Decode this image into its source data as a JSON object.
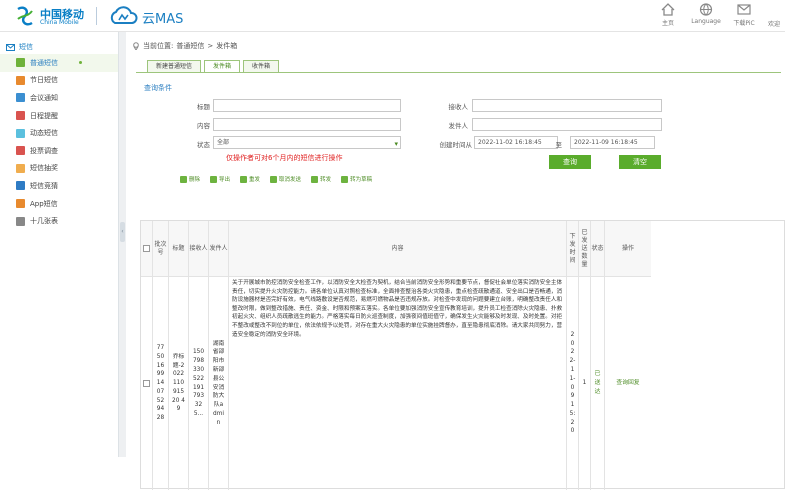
{
  "header": {
    "brand_cn": "中国移动",
    "brand_en": "China Mobile",
    "product": "云MAS",
    "nav": [
      {
        "label": "主页",
        "icon": "home-icon"
      },
      {
        "label": "Language",
        "icon": "globe-icon"
      },
      {
        "label": "下载PiC",
        "icon": "download-icon"
      }
    ],
    "welcome": "欢迎"
  },
  "sidebar": {
    "section": "短信",
    "items": [
      {
        "label": "普通短信",
        "active": true,
        "icon_color": "#6fb23a"
      },
      {
        "label": "节日短信",
        "active": false,
        "icon_color": "#e88a2e"
      },
      {
        "label": "会议通知",
        "active": false,
        "icon_color": "#3b8fd1"
      },
      {
        "label": "日程提醒",
        "active": false,
        "icon_color": "#d9534f"
      },
      {
        "label": "动态短信",
        "active": false,
        "icon_color": "#5bc0de"
      },
      {
        "label": "投票调查",
        "active": false,
        "icon_color": "#d9534f"
      },
      {
        "label": "短信抽奖",
        "active": false,
        "icon_color": "#f0ad4e"
      },
      {
        "label": "短信竞猜",
        "active": false,
        "icon_color": "#2e7bc4"
      },
      {
        "label": "App短信",
        "active": false,
        "icon_color": "#e88a2e"
      },
      {
        "label": "十几张表",
        "active": false,
        "icon_color": "#888888"
      }
    ]
  },
  "breadcrumb": {
    "prefix": "当前位置:",
    "path": [
      "普通短信",
      "发件箱"
    ]
  },
  "tabs": [
    {
      "label": "新建普通短信",
      "active": false
    },
    {
      "label": "发件箱",
      "active": true
    },
    {
      "label": "收件箱",
      "active": false
    }
  ],
  "query": {
    "title": "查询条件",
    "fields": {
      "title_label": "标题",
      "receiver_label": "接收人",
      "content_label": "内容",
      "sender_label": "发件人",
      "status_label": "状态",
      "status_value": "全部",
      "time_label": "创建时间从",
      "time_from": "2022-11-02 16:18:45",
      "time_to_label": "至",
      "time_to": "2022-11-09 16:18:45"
    },
    "hint": "仅操作者可对6个月内的短信进行操作",
    "query_button": "查询",
    "clear_button": "清空"
  },
  "toolbar": [
    "删除",
    "导出",
    "重发",
    "取消发送",
    "转发",
    "转为草稿"
  ],
  "table": {
    "headers": [
      "",
      "批次号",
      "标题",
      "接收人",
      "发件人",
      "内容",
      "下发时间",
      "已发送数量",
      "状态",
      "操作"
    ],
    "row": {
      "batch": "775016991407529428",
      "title": "乔标题-202211091520 49",
      "receiver": "150798330522191793325...",
      "sender": "湖南省邵阳市新邵县公安消防大队admin",
      "content": "关于开展城市防控消防安全检查工作，以消防安全大检查为契机，结合当前消防安全形势和重要节点，督促社会单位落实消防安全主体责任，切实提升火灾防控能力。请各单位认真对照检查标准，全面排查整治各类火灾隐患，重点检查疏散通道、安全出口是否畅通，消防设施器材是否完好有效，电气线路敷设是否规范，易燃可燃物品是否违规存放。对检查中发现的问题要建立台账，明确整改责任人和整改时限，做到整改措施、责任、资金、时限和预案五落实。各单位要加强消防安全宣传教育培训，提升员工检查消除火灾隐患、扑救初起火灾、组织人员疏散逃生的能力。严格落实每日防火巡查制度，加强夜间值班值守，确保发生火灾能够及时发现、及时处置。对拒不整改或整改不到位的单位，依法依规予以处罚，对存在重大火灾隐患的单位实施挂牌督办，直至隐患彻底消除。请大家共同努力，营造安全稳定的消防安全环境。",
      "time": "2022-11-09 15:20",
      "count": "1",
      "status": "已送达",
      "action": "查询回复"
    }
  }
}
